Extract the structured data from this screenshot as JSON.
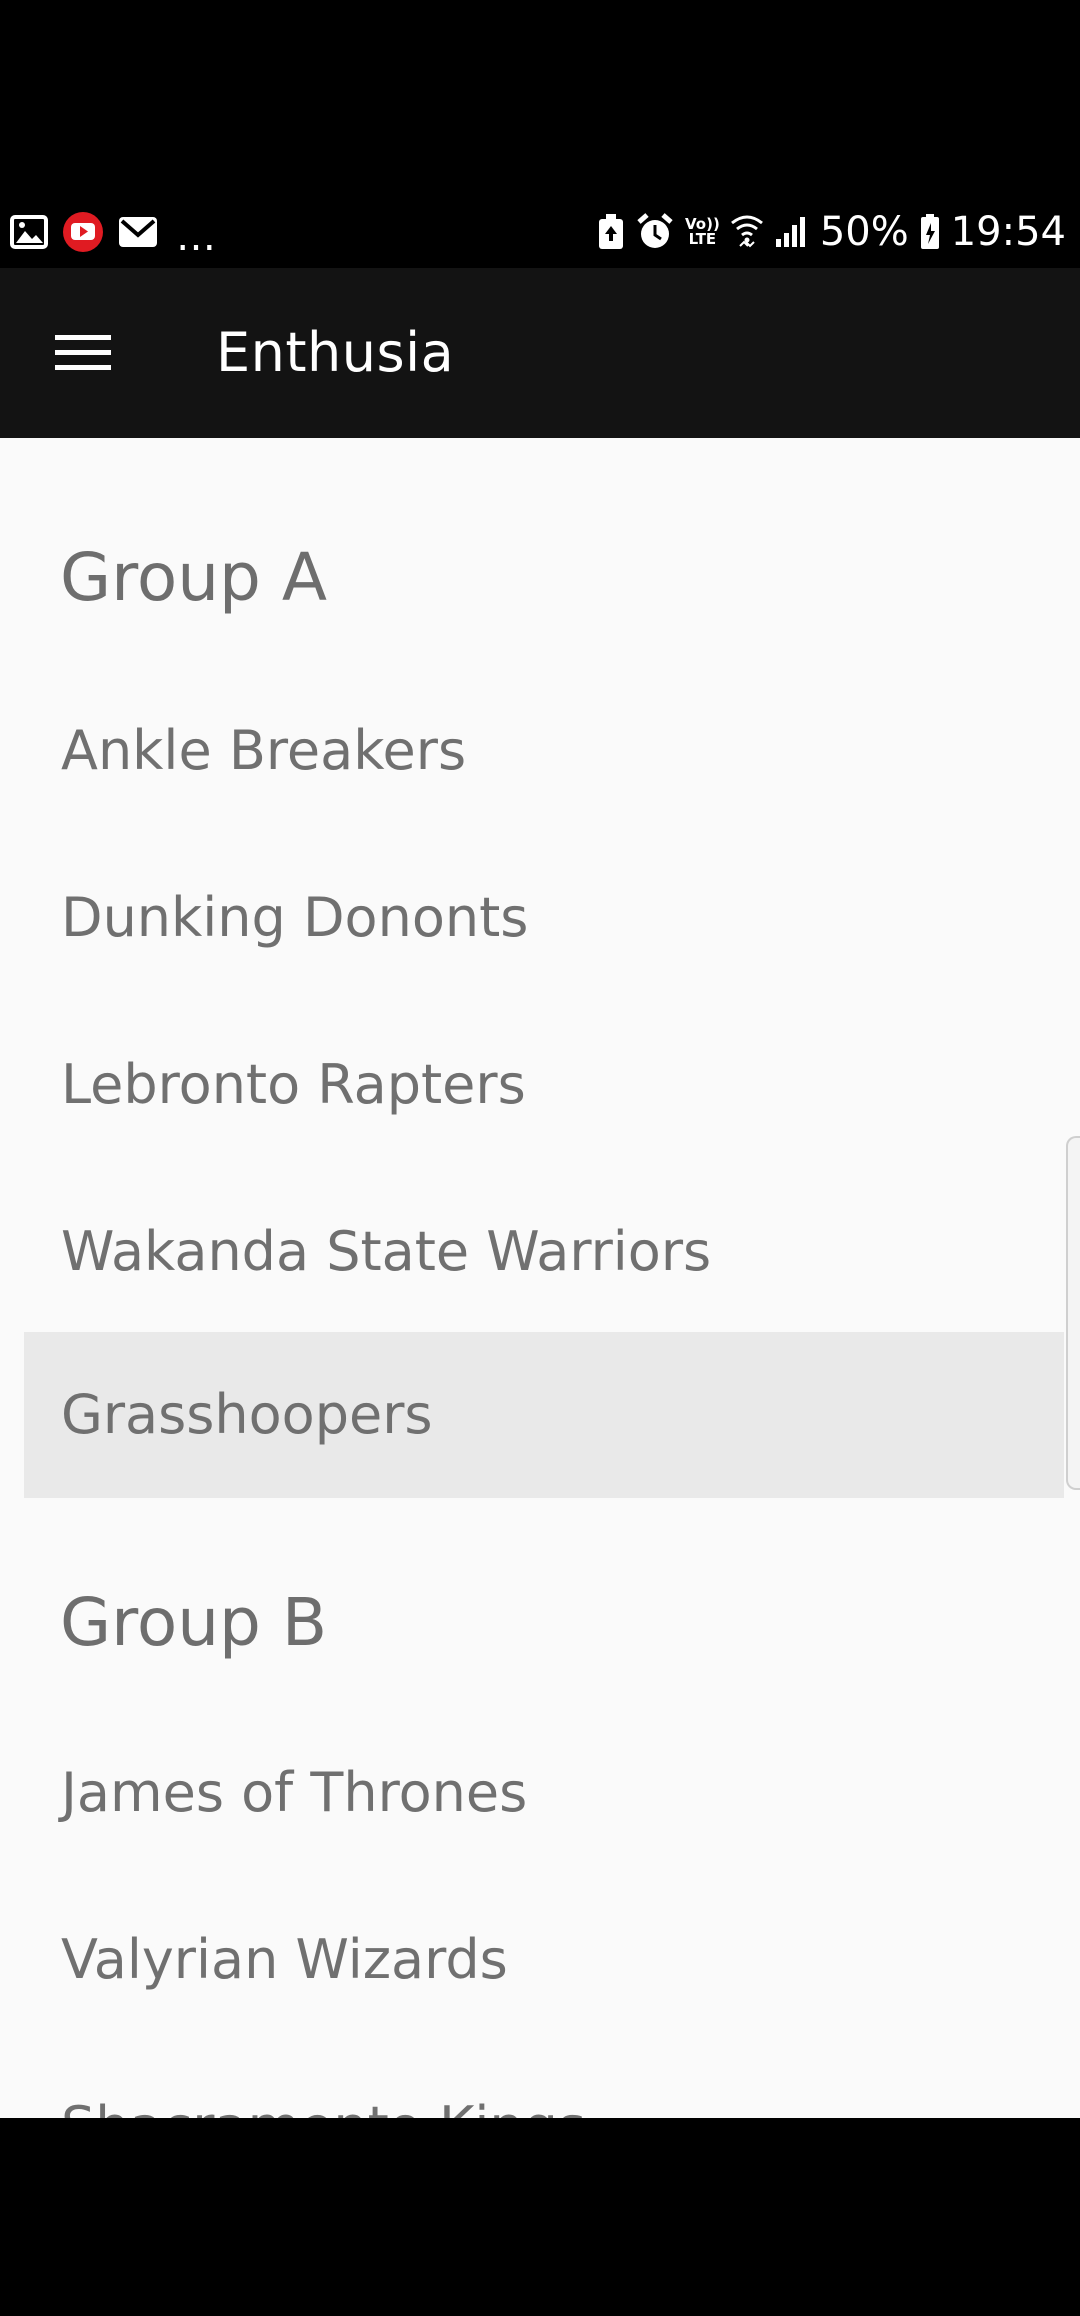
{
  "status_bar": {
    "left_icons": [
      "gallery-icon",
      "youtube-icon",
      "mail-icon"
    ],
    "more_indicator": "…",
    "right_icons": [
      "battery-saver-icon",
      "alarm-icon",
      "volte-icon",
      "wifi-icon",
      "signal-icon"
    ],
    "volte_top": "Vo))",
    "volte_bottom": "LTE",
    "battery_percent": "50%",
    "time": "19:54"
  },
  "app_bar": {
    "title": "Enthusia",
    "menu_icon": "hamburger-menu-icon"
  },
  "groups": [
    {
      "name": "Group A",
      "teams": [
        "Ankle Breakers",
        "Dunking Dononts",
        "Lebronto Rapters",
        "Wakanda State Warriors",
        "Grasshoopers"
      ]
    },
    {
      "name": "Group B",
      "teams": [
        "James of Thrones",
        "Valyrian Wizards",
        "Shacramento Kings"
      ]
    }
  ],
  "selected_team": "Grasshoopers",
  "colors": {
    "app_bar": "#131313",
    "background": "#fafafa",
    "text": "#707070",
    "selected_row": "#e9e9e9"
  }
}
